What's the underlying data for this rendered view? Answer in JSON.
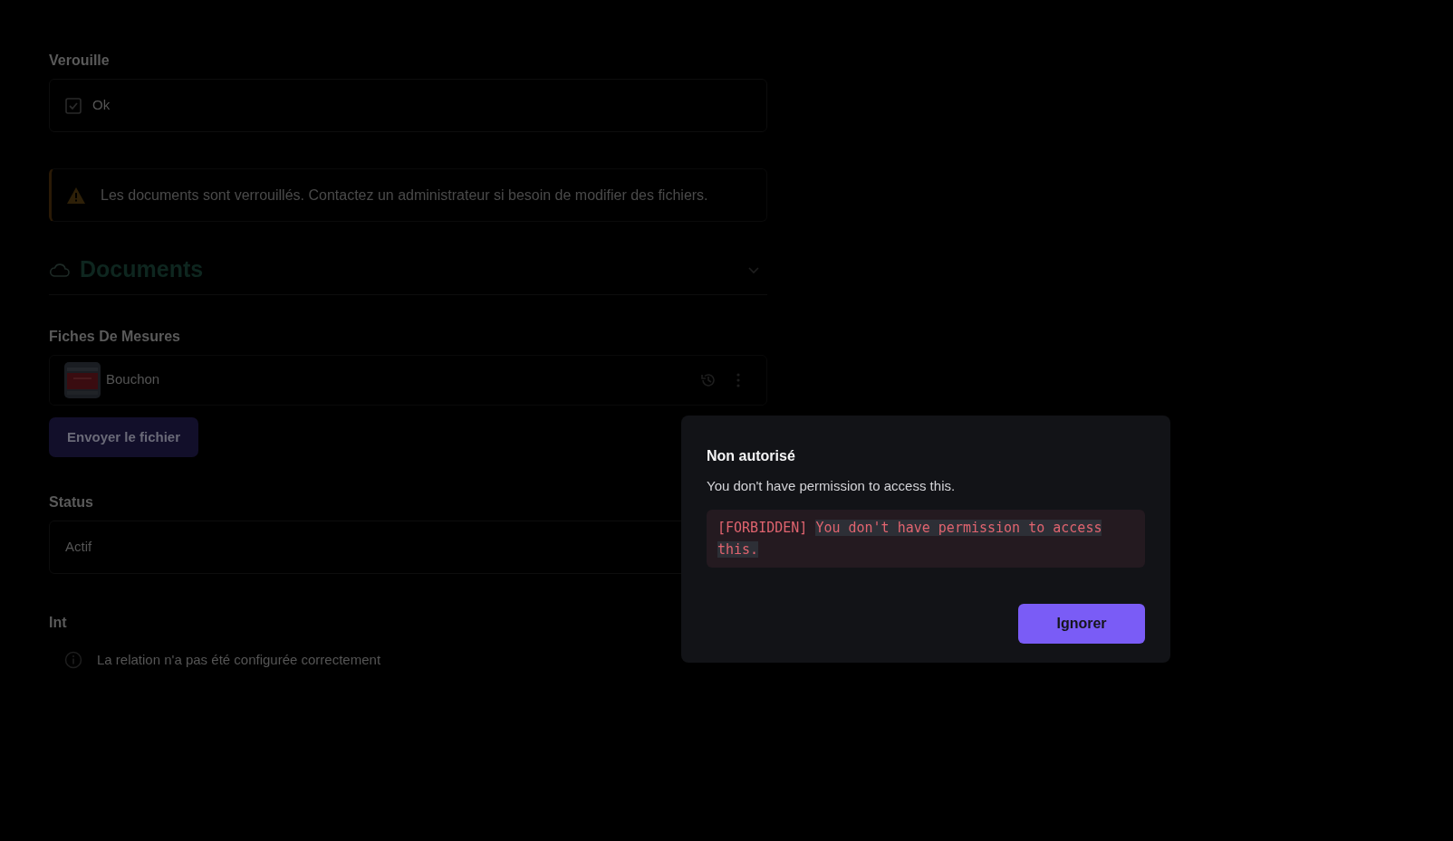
{
  "form": {
    "locked": {
      "label": "Verouille",
      "checked": true,
      "option": "Ok"
    },
    "alert": {
      "text": "Les documents sont verrouillés. Contactez un administrateur si besoin de modifier des fichiers."
    },
    "documents": {
      "title": "Documents",
      "expanded": true,
      "files_label": "Fiches De Mesures",
      "files": [
        {
          "name": "Bouchon"
        }
      ],
      "upload_button": "Envoyer le fichier"
    },
    "status": {
      "label": "Status",
      "value": "Actif"
    },
    "int": {
      "label": "Int",
      "info": "La relation n'a pas été configurée correctement"
    }
  },
  "dialog": {
    "title": "Non autorisé",
    "message": "You don't have permission to access this.",
    "error": {
      "code": "[FORBIDDEN]",
      "text": "You don't have permission to access this.",
      "highlighted": true
    },
    "button": "Ignorer"
  }
}
